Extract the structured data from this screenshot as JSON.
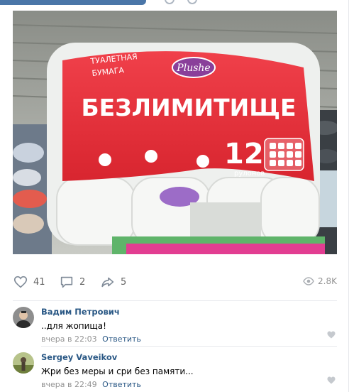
{
  "post": {
    "likes": "41",
    "comments": "2",
    "shares": "5",
    "views": "2.8K"
  },
  "photo": {
    "brand": "Plushe",
    "product_line1": "ТУАЛЕТНАЯ",
    "product_line2": "БУМАГА",
    "headline": "БЕЗЛИМИТИЩЕ",
    "count": "12",
    "count_unit": "рулонов"
  },
  "comments": [
    {
      "author": "Вадим Петрович",
      "text": "..для жопища!",
      "time": "вчера в 22:03",
      "reply": "Ответить"
    },
    {
      "author": "Sergey Vaveikov",
      "text": "Жри без меры и сри без памяти...",
      "time": "вчера в 22:49",
      "reply": "Ответить"
    }
  ],
  "colors": {
    "link": "#2a5885",
    "muted": "#939393",
    "icon": "#818c99",
    "package_red": "#e8303a"
  }
}
